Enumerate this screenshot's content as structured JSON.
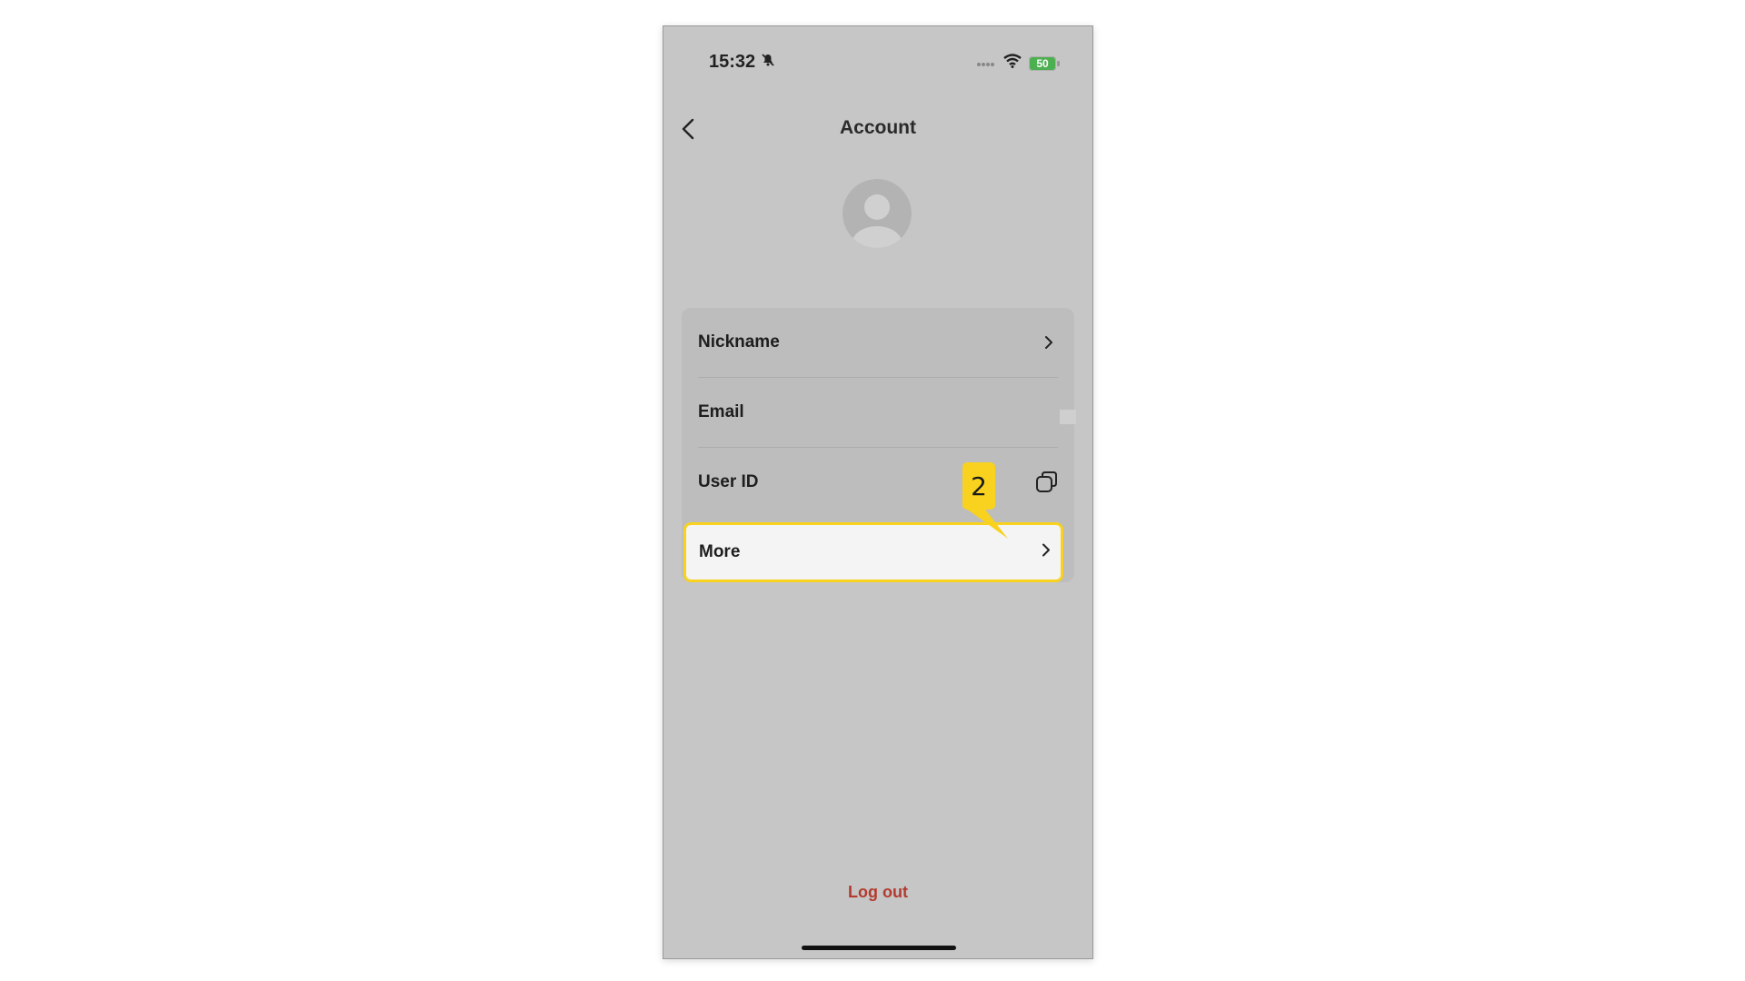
{
  "status_bar": {
    "time": "15:32",
    "battery_level": "50"
  },
  "header": {
    "title": "Account"
  },
  "account_items": [
    {
      "label": "Nickname"
    },
    {
      "label": "Email"
    },
    {
      "label": "User ID"
    },
    {
      "label": "More"
    }
  ],
  "annotation": {
    "step": "2"
  },
  "logout_label": "Log out",
  "colors": {
    "highlight": "#f8d21e",
    "logout": "#b33a2e",
    "battery": "#4caf50",
    "background_dim": "#c6c6c6"
  },
  "icons": {
    "back": "chevron-left-icon",
    "chevron": "chevron-right-icon",
    "copy": "copy-icon",
    "avatar": "user-avatar-icon",
    "mute": "bell-slash-icon",
    "wifi": "wifi-icon",
    "signal": "signal-icon"
  }
}
